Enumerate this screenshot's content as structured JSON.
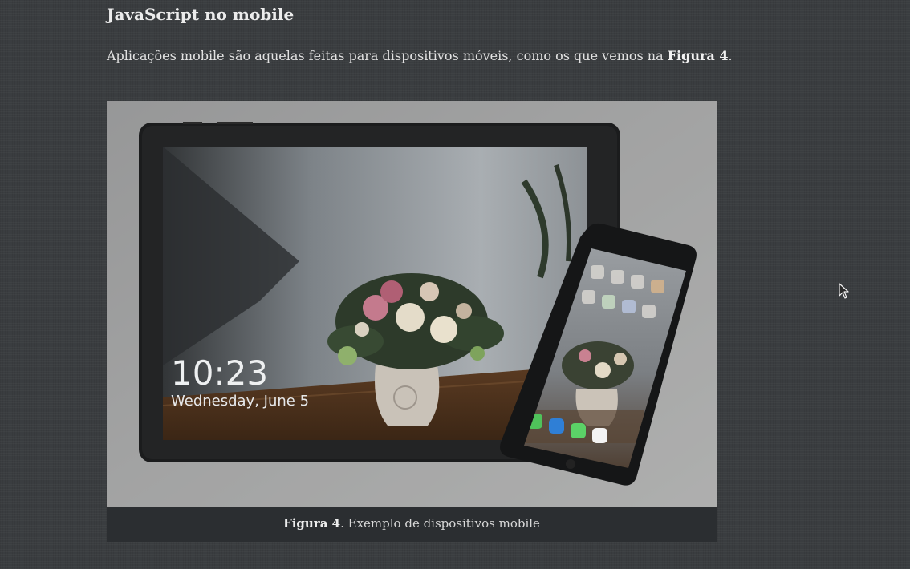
{
  "article": {
    "heading": "JavaScript no mobile",
    "paragraph_text": "Aplicações mobile são aquelas feitas para dispositivos móveis, como os que vemos na ",
    "paragraph_ref": "Figura 4",
    "paragraph_end": "."
  },
  "figure": {
    "tablet_time": "10:23",
    "tablet_date": "Wednesday, June 5",
    "caption_ref": "Figura 4",
    "caption_text": ". Exemplo de dispositivos mobile"
  },
  "icons": {
    "cursor": "arrow-pointer-icon"
  }
}
